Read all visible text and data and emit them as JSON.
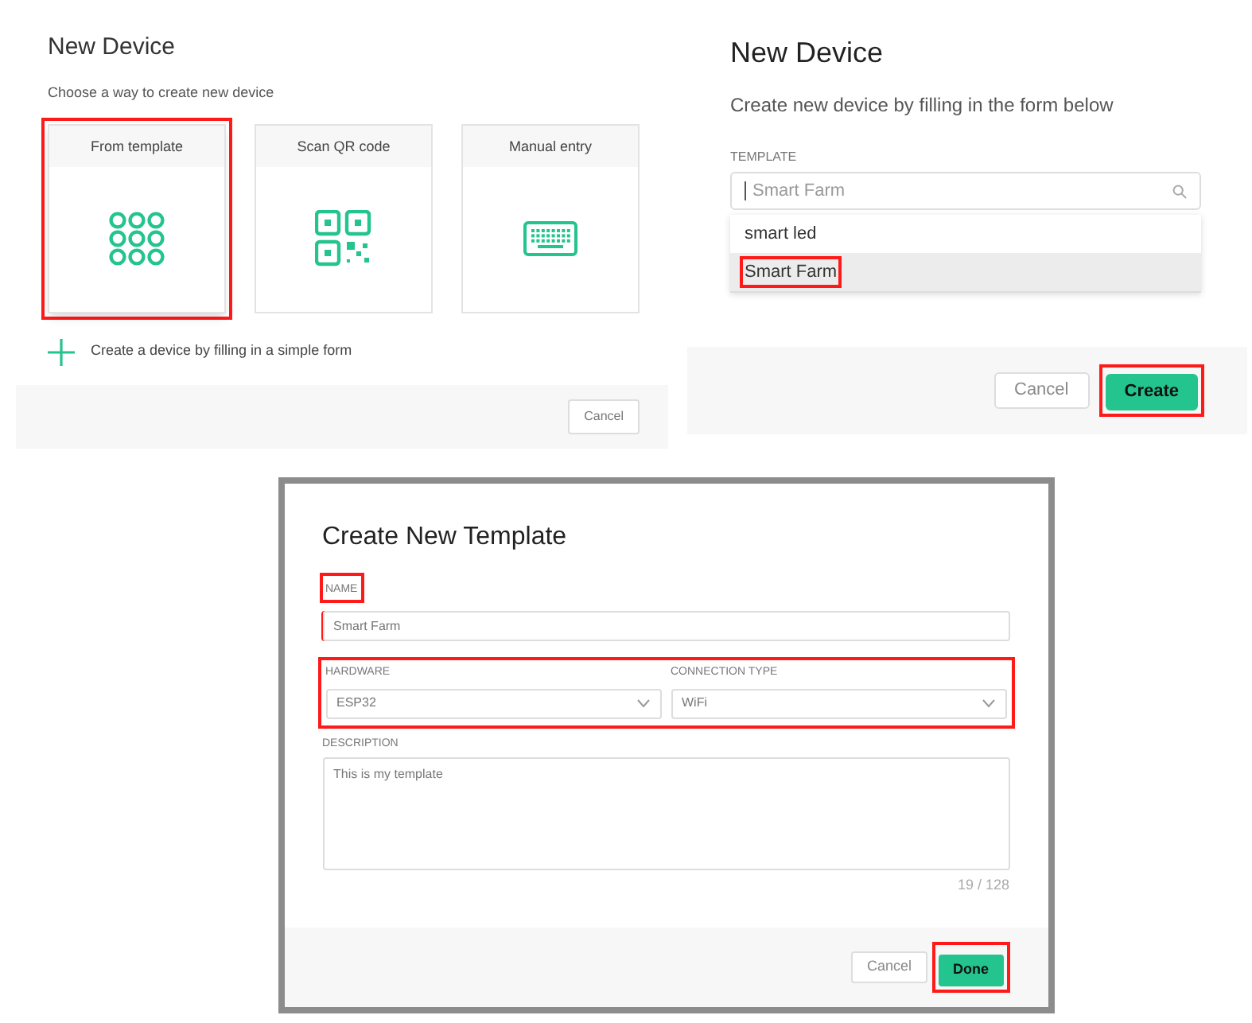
{
  "choose_panel": {
    "title": "New Device",
    "subtitle": "Choose a way to create new device",
    "options": [
      {
        "kind": "template",
        "label": "From template",
        "highlighted": true
      },
      {
        "kind": "qr",
        "label": "Scan QR code",
        "highlighted": false
      },
      {
        "kind": "keyboard",
        "label": "Manual entry",
        "highlighted": false
      }
    ],
    "simple_form_link": "Create a device by filling in a simple form",
    "cancel_button": "Cancel"
  },
  "form_panel": {
    "title": "New Device",
    "subtitle": "Create new device by filling in the form below",
    "template_label": "TEMPLATE",
    "template_search": "Smart Farm",
    "dropdown_options": [
      {
        "label": "smart led",
        "selected": false,
        "highlighted": false
      },
      {
        "label": "Smart Farm",
        "selected": true,
        "highlighted": true
      }
    ],
    "cancel_button": "Cancel",
    "create_button": {
      "label": "Create",
      "highlighted": true
    }
  },
  "template_dialog": {
    "title": "Create New Template",
    "name": {
      "label": "NAME",
      "value": "Smart Farm",
      "highlighted": true
    },
    "device_row": {
      "highlighted": true,
      "hardware": {
        "label": "HARDWARE",
        "value": "ESP32"
      },
      "connection_type": {
        "label": "CONNECTION TYPE",
        "value": "WiFi"
      }
    },
    "description": {
      "label": "DESCRIPTION",
      "value": "This is my template",
      "counter": "19 / 128"
    },
    "cancel_button": "Cancel",
    "done_button": {
      "label": "Done",
      "highlighted": true
    }
  }
}
